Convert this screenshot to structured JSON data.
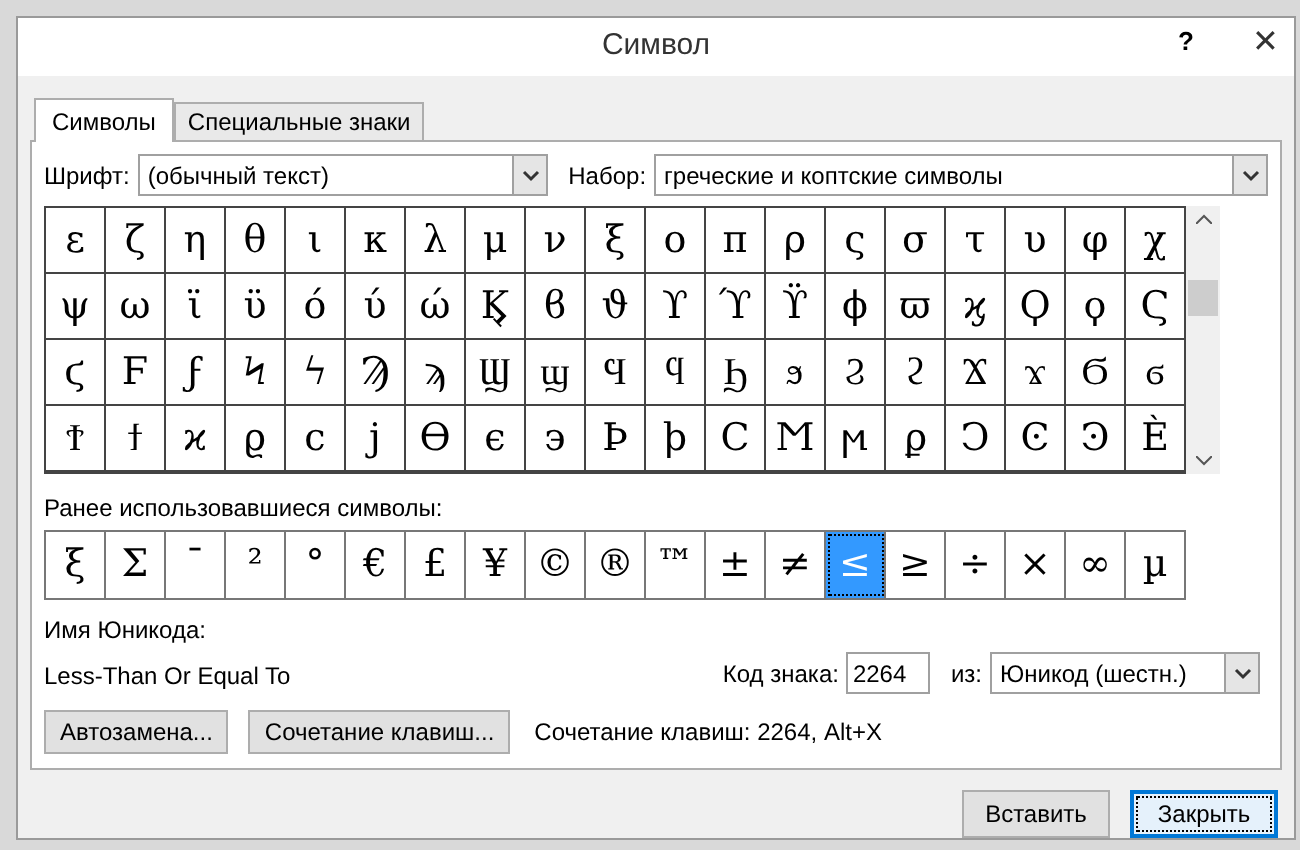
{
  "window": {
    "title": "Символ",
    "help": "?",
    "close": "✕"
  },
  "tabs": [
    {
      "label": "Символы",
      "selected": true
    },
    {
      "label": "Специальные знаки",
      "selected": false
    }
  ],
  "font": {
    "label": "Шрифт:",
    "value": "(обычный текст)"
  },
  "subset": {
    "label": "Набор:",
    "value": "греческие и коптские символы"
  },
  "grid": [
    [
      "ε",
      "ζ",
      "η",
      "θ",
      "ι",
      "κ",
      "λ",
      "μ",
      "ν",
      "ξ",
      "ο",
      "π",
      "ρ",
      "ς",
      "σ",
      "τ",
      "υ",
      "φ",
      "χ"
    ],
    [
      "ψ",
      "ω",
      "ϊ",
      "ϋ",
      "ό",
      "ύ",
      "ώ",
      "Ϗ",
      "ϐ",
      "ϑ",
      "ϒ",
      "ϓ",
      "ϔ",
      "ϕ",
      "ϖ",
      "ϗ",
      "Ϙ",
      "ϙ",
      "Ϛ"
    ],
    [
      "ϛ",
      "Ϝ",
      "ϝ",
      "Ϟ",
      "ϟ",
      "Ϡ",
      "ϡ",
      "Ϣ",
      "ϣ",
      "Ϥ",
      "ϥ",
      "Ϧ",
      "ϧ",
      "Ϩ",
      "ϩ",
      "Ϫ",
      "ϫ",
      "Ϭ",
      "ϭ"
    ],
    [
      "Ϯ",
      "ϯ",
      "ϰ",
      "ϱ",
      "ϲ",
      "ϳ",
      "ϴ",
      "ϵ",
      "϶",
      "Ϸ",
      "ϸ",
      "Ϲ",
      "Ϻ",
      "ϻ",
      "ϼ",
      "Ͻ",
      "Ͼ",
      "Ͽ",
      "Ѐ"
    ]
  ],
  "recent": {
    "label": "Ранее использовавшиеся символы:",
    "symbols": [
      {
        "char": "ξ",
        "selected": false
      },
      {
        "char": "Σ",
        "selected": false
      },
      {
        "char": "¯",
        "selected": false
      },
      {
        "char": "²",
        "selected": false
      },
      {
        "char": "°",
        "selected": false
      },
      {
        "char": "€",
        "selected": false
      },
      {
        "char": "£",
        "selected": false
      },
      {
        "char": "¥",
        "selected": false
      },
      {
        "char": "©",
        "selected": false
      },
      {
        "char": "®",
        "selected": false
      },
      {
        "char": "™",
        "selected": false
      },
      {
        "char": "±",
        "selected": false
      },
      {
        "char": "≠",
        "selected": false
      },
      {
        "char": "≤",
        "selected": true
      },
      {
        "char": "≥",
        "selected": false
      },
      {
        "char": "÷",
        "selected": false
      },
      {
        "char": "×",
        "selected": false
      },
      {
        "char": "∞",
        "selected": false
      },
      {
        "char": "µ",
        "selected": false
      }
    ]
  },
  "unicode_name": {
    "label": "Имя Юникода:",
    "value": "Less-Than Or Equal To"
  },
  "char_code": {
    "label": "Код знака:",
    "value": "2264"
  },
  "from": {
    "label": "из:",
    "value": "Юникод (шестн.)"
  },
  "buttons": [
    "Автозамена...",
    "Сочетание клавиш..."
  ],
  "shortcut": "Сочетание клавиш: 2264, Alt+X",
  "insert": "Вставить",
  "close_button": "Закрыть"
}
